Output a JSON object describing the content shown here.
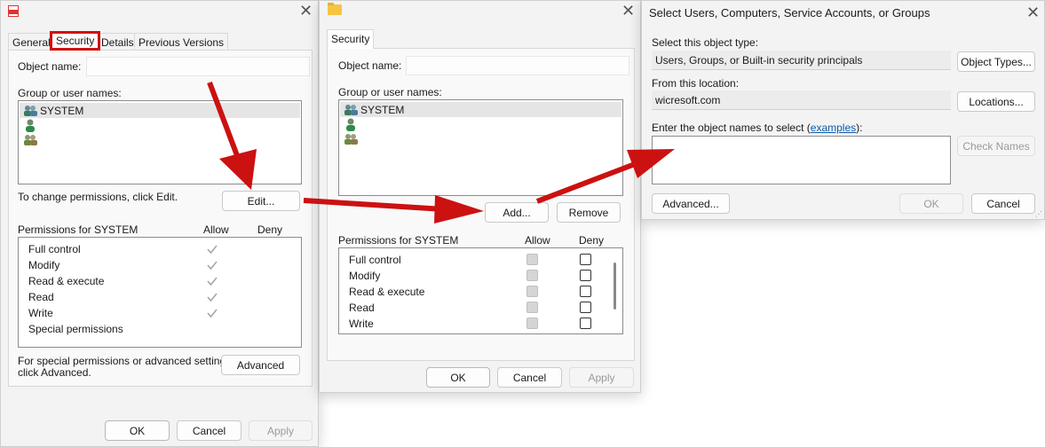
{
  "win1": {
    "tabs": [
      "General",
      "Security",
      "Details",
      "Previous Versions"
    ],
    "object_name_label": "Object name:",
    "group_label": "Group or user names:",
    "users": [
      "SYSTEM",
      "",
      ""
    ],
    "change_text": "To change permissions, click Edit.",
    "edit_btn": "Edit...",
    "perm_for": "Permissions for SYSTEM",
    "allow": "Allow",
    "deny": "Deny",
    "perms": [
      "Full control",
      "Modify",
      "Read & execute",
      "Read",
      "Write",
      "Special permissions"
    ],
    "allow_checked": [
      true,
      true,
      true,
      true,
      true,
      false
    ],
    "special_text_1": "For special permissions or advanced settings,",
    "special_text_2": "click Advanced.",
    "advanced_btn": "Advanced",
    "ok": "OK",
    "cancel": "Cancel",
    "apply": "Apply"
  },
  "win2": {
    "tab": "Security",
    "object_name_label": "Object name:",
    "group_label": "Group or user names:",
    "users": [
      "SYSTEM",
      "",
      ""
    ],
    "add_btn": "Add...",
    "remove_btn": "Remove",
    "perm_for": "Permissions for SYSTEM",
    "allow": "Allow",
    "deny": "Deny",
    "perms": [
      "Full control",
      "Modify",
      "Read & execute",
      "Read",
      "Write"
    ],
    "ok": "OK",
    "cancel": "Cancel",
    "apply": "Apply"
  },
  "win3": {
    "title": "Select Users, Computers, Service Accounts, or Groups",
    "type_label": "Select this object type:",
    "type_value": "Users, Groups, or Built-in security principals",
    "object_types_btn": "Object Types...",
    "location_label": "From this location:",
    "location_value": "wicresoft.com",
    "locations_btn": "Locations...",
    "enter_label_pre": "Enter the object names to select (",
    "enter_label_link": "examples",
    "enter_label_post": "):",
    "check_names_btn": "Check Names",
    "advanced_btn": "Advanced...",
    "ok": "OK",
    "cancel": "Cancel"
  },
  "colors": {
    "annotation_red": "#cc1111",
    "link": "#0b5cad"
  },
  "icons": [
    "pdf-file-icon",
    "folder-icon",
    "close-icon",
    "users-group-icon",
    "user-icon",
    "checkmark-icon"
  ]
}
